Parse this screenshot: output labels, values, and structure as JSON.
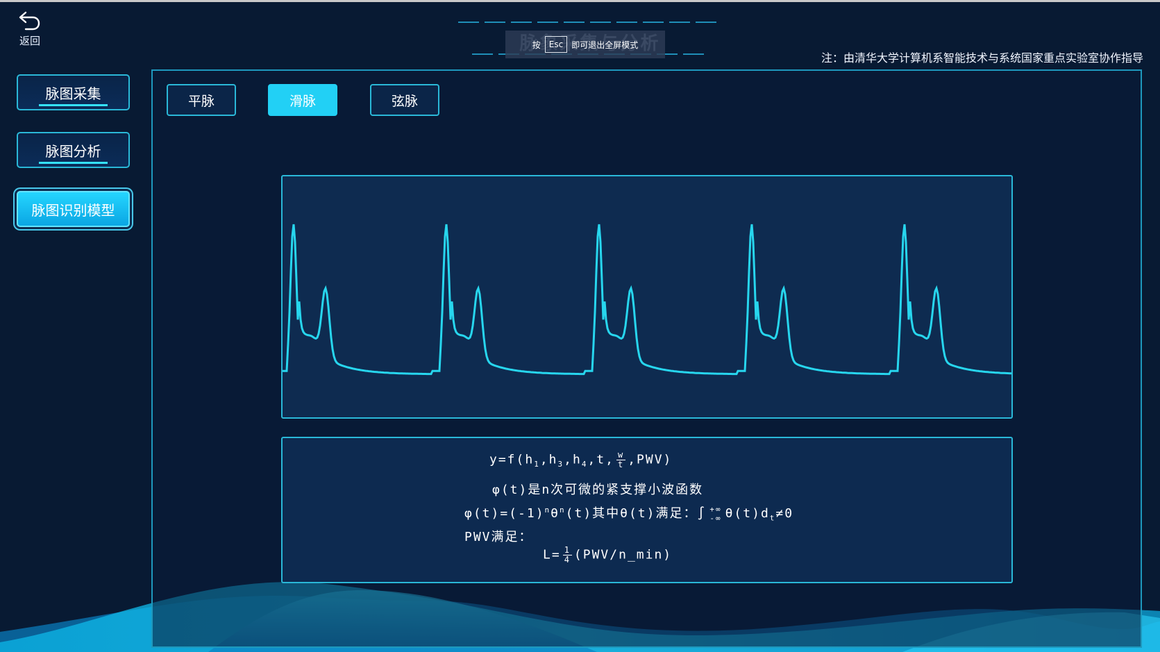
{
  "header": {
    "back_label": "返回",
    "title": "脉象采集与分析",
    "esc_prefix": "按",
    "esc_key": "Esc",
    "esc_suffix": "即可退出全屏模式",
    "note": "注：由清华大学计算机系智能技术与系统国家重点实验室协作指导"
  },
  "sidebar": {
    "items": [
      {
        "label": "脉图采集",
        "active": false
      },
      {
        "label": "脉图分析",
        "active": false
      },
      {
        "label": "脉图识别模型",
        "active": true
      }
    ]
  },
  "tabs": [
    {
      "label": "平脉",
      "active": false
    },
    {
      "label": "滑脉",
      "active": true
    },
    {
      "label": "弦脉",
      "active": false
    }
  ],
  "waveform": {
    "line_color": "#27d6ee",
    "cycle_count": 5
  },
  "formula": {
    "line1_prefix": "y=f(h",
    "sub1": "1",
    "h3": ",h",
    "sub3": "3",
    "h4": ",h",
    "sub4": "4",
    "t_part": ",t,",
    "frac_num": "w",
    "frac_den": "t",
    "line1_suffix": ",PWV)",
    "line2": "φ(t)是n次可微的紧支撑小波函数",
    "line3_prefix": "φ(t)=(-1)",
    "sup_n1": "n",
    "theta": "θ",
    "sup_n2": "n",
    "line3_mid": "(t)其中θ(t)满足：∫",
    "upper": "+∞",
    "lower": "-∞",
    "line3_tail": "θ(t)d",
    "sub_t": "t",
    "line3_end": "≠0",
    "line4": "PWV满足：",
    "line5_prefix": "L=",
    "frac2_num": "1",
    "frac2_den": "4",
    "line5_suffix": "(PWV/n_min)"
  },
  "colors": {
    "accent": "#22d0f5",
    "border": "#2ab8d8",
    "background": "#081a33"
  }
}
